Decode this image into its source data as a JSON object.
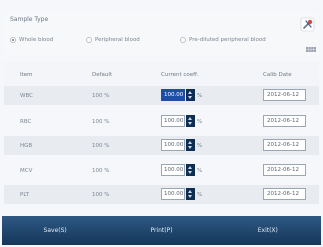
{
  "sample_type": {
    "title": "Sample Type",
    "options": [
      {
        "label": "Whole blood",
        "selected": true
      },
      {
        "label": "Peripheral blood",
        "selected": false
      },
      {
        "label": "Pre-diluted peripheral blood",
        "selected": false
      }
    ]
  },
  "table": {
    "headers": [
      "Item",
      "Default",
      "Current coeff.",
      "Calib Date"
    ],
    "rows": [
      {
        "item": "WBC",
        "default": "100 %",
        "coeff": "100.00",
        "unit": "%",
        "date": "2012-06-12",
        "active": true
      },
      {
        "item": "RBC",
        "default": "100 %",
        "coeff": "100.00",
        "unit": "%",
        "date": "2012-06-12",
        "active": false
      },
      {
        "item": "HGB",
        "default": "100 %",
        "coeff": "100.00",
        "unit": "%",
        "date": "2012-06-12",
        "active": false
      },
      {
        "item": "MCV",
        "default": "100 %",
        "coeff": "100.00",
        "unit": "%",
        "date": "2012-06-12",
        "active": false
      },
      {
        "item": "PLT",
        "default": "100 %",
        "coeff": "100.00",
        "unit": "%",
        "date": "2012-06-12",
        "active": false
      }
    ]
  },
  "footer": {
    "save_label": "Save(S)",
    "print_label": "Print(P)",
    "exit_label": "Exit(X)"
  },
  "icons": [
    "tools-icon",
    "grid-icon",
    "spin-arrows-icon"
  ],
  "colors": {
    "footer_top": "#2f5883",
    "footer_bottom": "#143759",
    "active_field": "#1e4f9c",
    "spin_button": "#0f2f52"
  }
}
